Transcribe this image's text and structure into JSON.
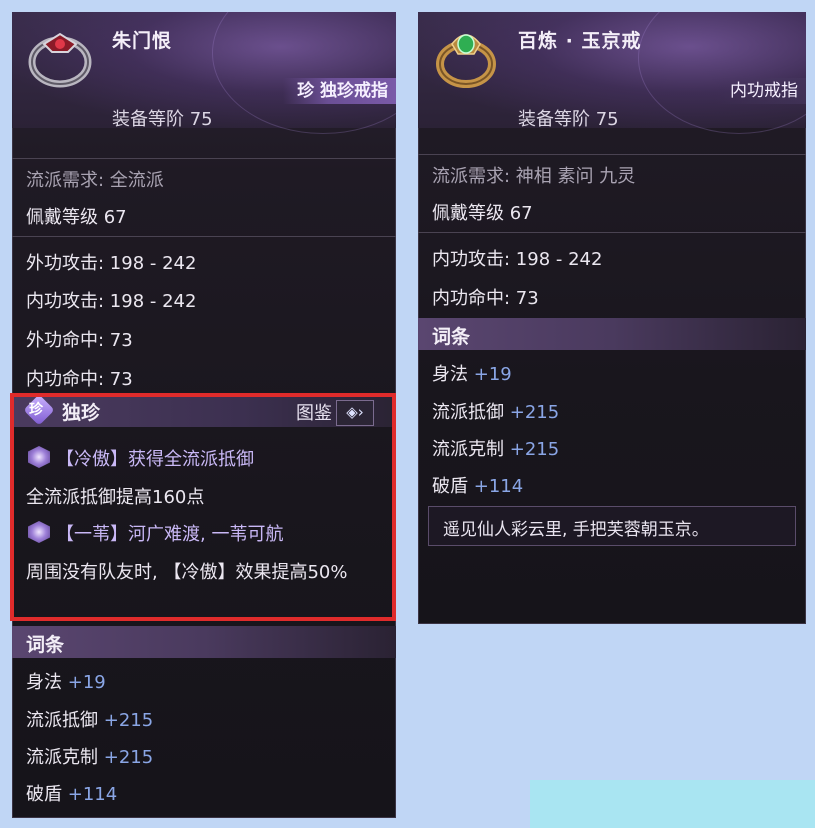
{
  "left_card": {
    "name": "朱门恨",
    "rarity_tag": "珍 独珍戒指",
    "tier": "装备等阶 75",
    "school_req": "流派需求: 全流派",
    "wear_level": "佩戴等级 67",
    "stats": [
      "外功攻击: 198 - 242",
      "内功攻击: 198 - 242",
      "外功命中: 73",
      "内功命中: 73"
    ],
    "unique": {
      "badge": "珍",
      "title": "独珍",
      "tujian_label": "图鉴",
      "skills": [
        {
          "title": "【冷傲】获得全流派抵御",
          "desc": "全流派抵御提高160点"
        },
        {
          "title": "【一苇】河广难渡, 一苇可航",
          "desc": "周围没有队友时, 【冷傲】效果提高50%"
        }
      ]
    },
    "affix_title": "词条",
    "affixes": [
      {
        "name": "身法",
        "value": "+19"
      },
      {
        "name": "流派抵御",
        "value": "+215"
      },
      {
        "name": "流派克制",
        "value": "+215"
      },
      {
        "name": "破盾",
        "value": "+114"
      }
    ]
  },
  "right_card": {
    "name": "百炼 · 玉京戒",
    "type_tag": "内功戒指",
    "tier": "装备等阶 75",
    "school_req": "流派需求: 神相 素问 九灵",
    "wear_level": "佩戴等级 67",
    "stats": [
      "内功攻击: 198 - 242",
      "内功命中: 73"
    ],
    "affix_title": "词条",
    "affixes": [
      {
        "name": "身法",
        "value": "+19"
      },
      {
        "name": "流派抵御",
        "value": "+215"
      },
      {
        "name": "流派克制",
        "value": "+215"
      },
      {
        "name": "破盾",
        "value": "+114"
      }
    ],
    "flavor": "遥见仙人彩云里, 手把芙蓉朝玉京。"
  },
  "colors": {
    "highlight_border": "#e02b2b",
    "affix_value": "#8aa6e6",
    "background": "#c0d6f5"
  }
}
